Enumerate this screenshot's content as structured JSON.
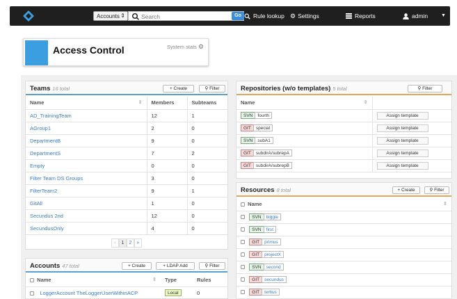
{
  "nav": {
    "scope_select": "Accounts",
    "search_placeholder": "Search",
    "go_label": "Go",
    "rule_lookup": "Rule lookup",
    "settings": "Settings",
    "reports": "Reports",
    "user": "admin"
  },
  "header": {
    "title": "Access Control",
    "system_stats": "System stats"
  },
  "teams": {
    "title": "Teams",
    "count": "16 total",
    "create": "+ Create",
    "filter": "Filter",
    "columns": [
      "Name",
      "Members",
      "Subteams"
    ],
    "rows": [
      {
        "name": "AD_TrainingTeam",
        "members": "12",
        "subteams": "1"
      },
      {
        "name": "AGroup1",
        "members": "2",
        "subteams": "0"
      },
      {
        "name": "DepartmentB",
        "members": "9",
        "subteams": "0"
      },
      {
        "name": "DepartmentS",
        "members": "7",
        "subteams": "2"
      },
      {
        "name": "Empty",
        "members": "0",
        "subteams": "0"
      },
      {
        "name": "Filter Team DS Groups",
        "members": "3",
        "subteams": "0"
      },
      {
        "name": "FilterTeam2",
        "members": "9",
        "subteams": "1"
      },
      {
        "name": "GitAll",
        "members": "1",
        "subteams": "0"
      },
      {
        "name": "Secundus 2nd",
        "members": "12",
        "subteams": "0"
      },
      {
        "name": "SecundusOnly",
        "members": "4",
        "subteams": "0"
      }
    ],
    "pager": {
      "prev": "«",
      "p1": "1",
      "p2": "2",
      "next": "»"
    }
  },
  "accounts": {
    "title": "Accounts",
    "count": "47 total",
    "create": "+ Create",
    "ldap": "+ LDAP Add",
    "filter": "Filter",
    "columns": [
      "Name",
      "Type",
      "Rules"
    ],
    "rows": [
      {
        "name": "LoggerAccount TheLoggerUserWithinACP",
        "type": "Local",
        "rules": "0"
      }
    ]
  },
  "repos": {
    "title": "Repositories (w/o templates)",
    "count": "5 total",
    "filter": "Filter",
    "column": "Name",
    "assign_label": "Assign template",
    "rows": [
      {
        "type": "SVN",
        "name": "fourth"
      },
      {
        "type": "GIT",
        "name": "special"
      },
      {
        "type": "SVN",
        "name": "subA1"
      },
      {
        "type": "GIT",
        "name": "subdirA/subrepA"
      },
      {
        "type": "GIT",
        "name": "subdirA/subrepB"
      }
    ]
  },
  "resources": {
    "title": "Resources",
    "count": "8 total",
    "create": "+ Create",
    "filter": "Filter",
    "column": "Name",
    "rows": [
      {
        "type": "SVN",
        "name": "biggie"
      },
      {
        "type": "SVN",
        "name": "first"
      },
      {
        "type": "GIT",
        "name": "primus"
      },
      {
        "type": "GIT",
        "name": "projectX"
      },
      {
        "type": "SVN",
        "name": "second"
      },
      {
        "type": "GIT",
        "name": "secundus"
      },
      {
        "type": "GIT",
        "name": "tertius"
      }
    ]
  }
}
